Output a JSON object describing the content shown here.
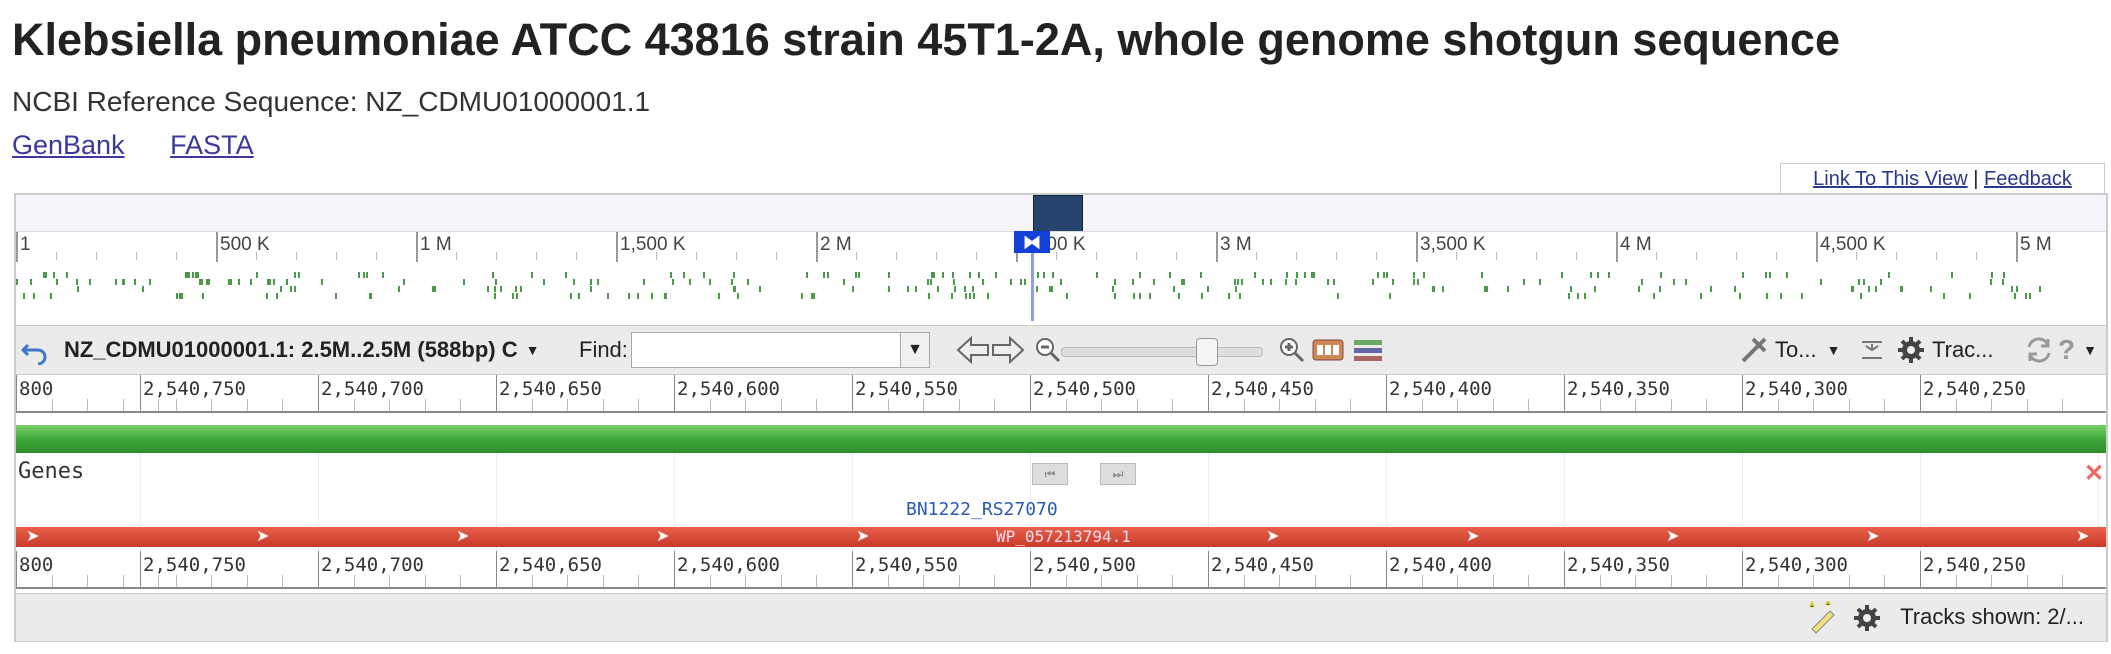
{
  "page": {
    "title": "Klebsiella pneumoniae ATCC 43816 strain 45T1-2A, whole genome shotgun sequence",
    "reference": "NCBI Reference Sequence: NZ_CDMU01000001.1",
    "links": [
      "GenBank",
      "FASTA"
    ],
    "link_to_view": "Link To This View",
    "separator": "|",
    "feedback": "Feedback"
  },
  "overview": {
    "ticks": [
      "1",
      "500 K",
      "1 M",
      "1,500 K",
      "2 M",
      "2,500 K",
      "3 M",
      "3,500 K",
      "4 M",
      "4,500 K",
      "5 M"
    ],
    "marker": "⧓"
  },
  "toolbar": {
    "back_icon": "undo-icon",
    "sequence_label": "NZ_CDMU01000001.1: 2.5M..2.5M (588bp) C",
    "find_label": "Find:",
    "find_value": "",
    "tools_label": "To...",
    "tracks_label": "Trac..."
  },
  "ruler": {
    "labels": [
      "800",
      "2,540,750",
      "2,540,700",
      "2,540,650",
      "2,540,600",
      "2,540,550",
      "2,540,500",
      "2,540,450",
      "2,540,400",
      "2,540,350",
      "2,540,300",
      "2,540,250"
    ]
  },
  "genes": {
    "track_label": "Genes",
    "gene_name": "BN1222_RS27070",
    "protein_name": "WP_057213794.1"
  },
  "footer": {
    "tracks_shown": "Tracks shown: 2/..."
  },
  "colors": {
    "gene_track": "#3fa83a",
    "protein_track": "#c83a2a",
    "selection": "#26446e",
    "marker": "#1240d8"
  }
}
